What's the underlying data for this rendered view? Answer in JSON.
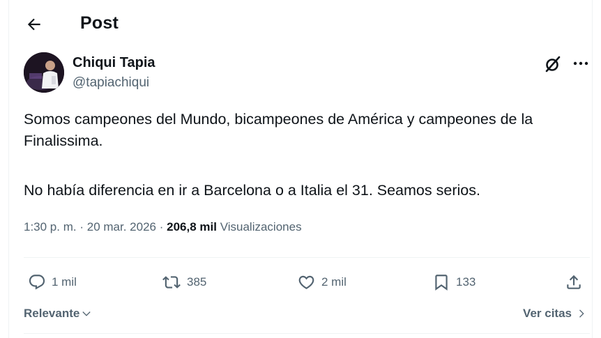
{
  "header": {
    "title": "Post"
  },
  "author": {
    "name": "Chiqui Tapia",
    "handle": "@tapiachiqui"
  },
  "tweet": {
    "paragraph1": "Somos campeones del Mundo, bicampeones de América y campeones de la Finalissima.",
    "paragraph2": "No había diferencia en ir a Barcelona o a Italia el 31. Seamos serios."
  },
  "meta": {
    "time": "1:30 p. m.",
    "separator": "·",
    "date": "20 mar. 2026",
    "views_count": "206,8 mil",
    "views_label": "Visualizaciones"
  },
  "actions": {
    "replies": "1 mil",
    "reposts": "385",
    "likes": "2 mil",
    "bookmarks": "133"
  },
  "footer": {
    "sort_label": "Relevante",
    "quotes_label": "Ver citas"
  },
  "icons": [
    "back-arrow-icon",
    "grok-icon",
    "more-icon",
    "reply-icon",
    "repost-icon",
    "like-icon",
    "bookmark-icon",
    "share-icon",
    "chevron-down-icon",
    "chevron-right-icon"
  ]
}
